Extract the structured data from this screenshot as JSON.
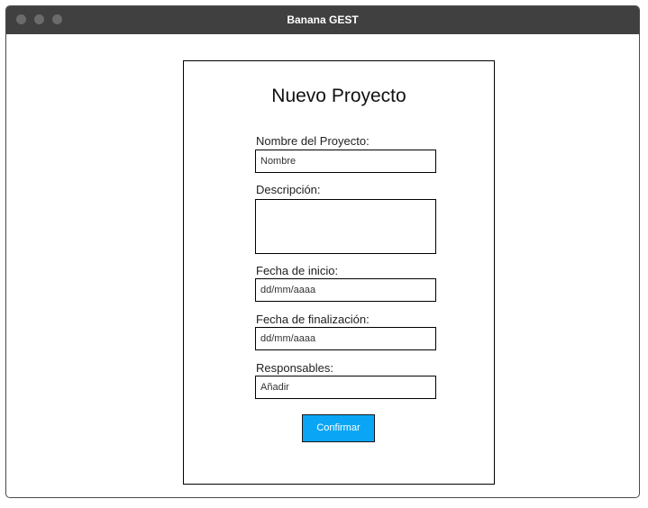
{
  "window": {
    "title": "Banana GEST"
  },
  "form": {
    "title": "Nuevo Proyecto",
    "fields": {
      "nombre": {
        "label": "Nombre del Proyecto:",
        "value": "Nombre"
      },
      "descripcion": {
        "label": "Descripción:",
        "value": ""
      },
      "fecha_inicio": {
        "label": "Fecha de inicio:",
        "value": "dd/mm/aaaa"
      },
      "fecha_fin": {
        "label": "Fecha de finalización:",
        "value": "dd/mm/aaaa"
      },
      "responsables": {
        "label": "Responsables:",
        "value": "Añadir"
      }
    },
    "confirm_label": "Confirmar"
  },
  "colors": {
    "titlebar": "#404040",
    "accent_button": "#0aa6f5"
  }
}
